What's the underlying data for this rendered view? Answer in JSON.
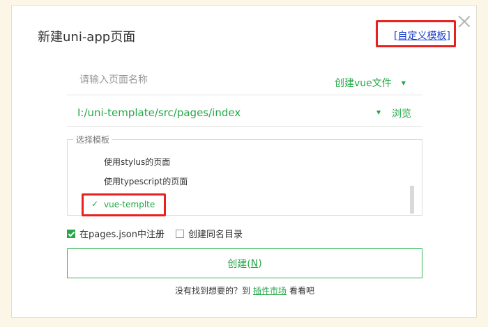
{
  "dialog": {
    "title": "新建uni-app页面",
    "custom_template_link": "自定义模板",
    "custom_link_bracket_open": "[",
    "custom_link_bracket_close": "]"
  },
  "page_name": {
    "value": "",
    "placeholder": "请输入页面名称"
  },
  "file_type": {
    "selected": "创建vue文件",
    "caret": "▼"
  },
  "path": {
    "value": "I:/uni-template/src/pages/index",
    "caret": "▼",
    "browse_label": "浏览"
  },
  "template_group": {
    "legend": "选择模板",
    "items": [
      {
        "label": "使用stylus的页面",
        "selected": false
      },
      {
        "label": "使用typescript的页面",
        "selected": false
      },
      {
        "label": "vue-templte",
        "selected": true
      }
    ],
    "check_mark": "✓"
  },
  "options": {
    "register_pages_json": {
      "label": "在pages.json中注册",
      "checked": true
    },
    "create_same_dir": {
      "label": "创建同名目录",
      "checked": false
    }
  },
  "create_button": {
    "label": "创建(",
    "key": "N",
    "label_end": ")"
  },
  "footer": {
    "prefix": "没有找到想要的？到",
    "market_link": "插件市场",
    "suffix": "看看吧"
  },
  "colors": {
    "accent_green": "#22a845",
    "highlight_red": "#e8201e",
    "link_blue": "#1a3ec8"
  }
}
